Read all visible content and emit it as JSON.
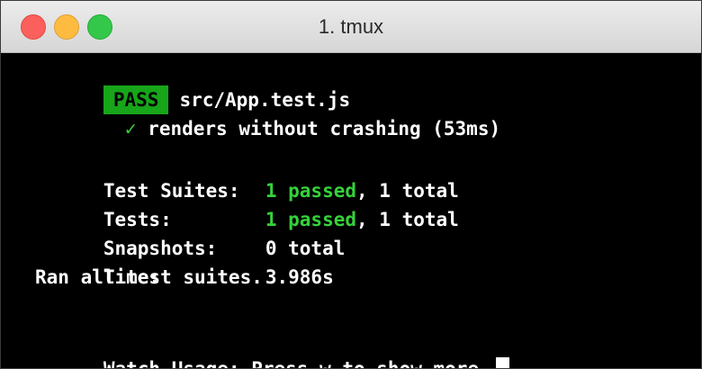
{
  "window": {
    "title": "1. tmux"
  },
  "terminal": {
    "status_badge": "PASS",
    "test_file": "src/App.test.js",
    "check_mark": "✓",
    "test_case": "renders without crashing (53ms)",
    "summary": {
      "suites_label": "Test Suites:",
      "suites_passed": "1 passed",
      "suites_rest": ", 1 total",
      "tests_label": "Tests:",
      "tests_passed": "1 passed",
      "tests_rest": ", 1 total",
      "snapshots_label": "Snapshots:",
      "snapshots_value": "0 total",
      "time_label": "Time:",
      "time_value": "3.986s",
      "ran_all": "Ran all test suites."
    },
    "watch_usage": "Watch Usage: Press w to show more."
  },
  "colors": {
    "pass_badge_bg": "#17a51a",
    "pass_text": "#35d23a",
    "background": "#000000",
    "foreground": "#ffffff"
  }
}
